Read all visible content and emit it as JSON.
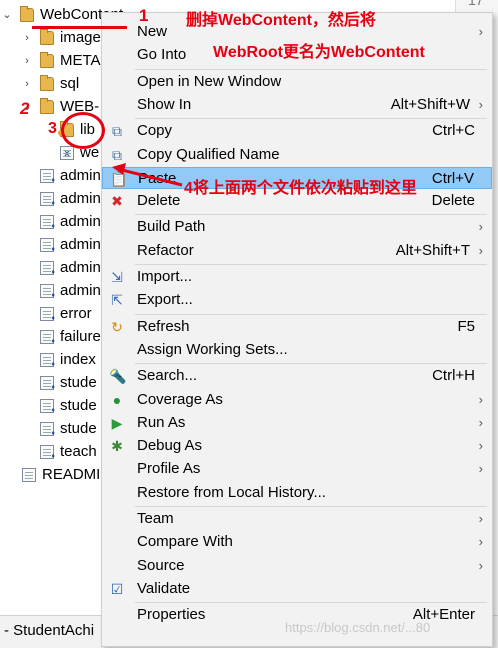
{
  "tree": {
    "root": {
      "label": "WebContent",
      "expander": "⌄"
    },
    "items": [
      {
        "label": "image",
        "icon": "folder-icon",
        "expander": "›"
      },
      {
        "label": "META",
        "icon": "folder-icon",
        "expander": "›"
      },
      {
        "label": "sql",
        "icon": "folder-icon",
        "expander": "›"
      },
      {
        "label": "WEB-",
        "icon": "folder-icon",
        "expander": "⌄"
      },
      {
        "label": "lib",
        "icon": "library-folder-icon",
        "expander": ""
      },
      {
        "label": "we",
        "icon": "xml-file-icon",
        "expander": ""
      },
      {
        "label": "admin",
        "icon": "jsp-file-icon"
      },
      {
        "label": "admin",
        "icon": "jsp-file-icon"
      },
      {
        "label": "admin",
        "icon": "jsp-file-icon"
      },
      {
        "label": "admin",
        "icon": "jsp-file-icon"
      },
      {
        "label": "admin",
        "icon": "jsp-file-icon"
      },
      {
        "label": "admin",
        "icon": "jsp-file-icon"
      },
      {
        "label": "error",
        "icon": "jsp-file-icon"
      },
      {
        "label": "failure",
        "icon": "jsp-file-icon"
      },
      {
        "label": "index",
        "icon": "jsp-file-icon"
      },
      {
        "label": "stude",
        "icon": "jsp-file-icon"
      },
      {
        "label": "stude",
        "icon": "jsp-file-icon"
      },
      {
        "label": "stude",
        "icon": "jsp-file-icon"
      },
      {
        "label": "teach",
        "icon": "jsp-file-icon"
      },
      {
        "label": "READMI",
        "icon": "text-file-icon"
      }
    ]
  },
  "bottom_bar": {
    "label": "- StudentAchi"
  },
  "right_panel": {
    "label": "17"
  },
  "context_menu": {
    "items": [
      {
        "label": "New",
        "shortcut": "",
        "submenu": true,
        "icon": ""
      },
      {
        "label": "Go Into",
        "shortcut": "",
        "submenu": false,
        "icon": ""
      },
      {
        "separator": true
      },
      {
        "label": "Open in New Window",
        "shortcut": "",
        "submenu": false,
        "icon": ""
      },
      {
        "label": "Show In",
        "shortcut": "Alt+Shift+W",
        "submenu": true,
        "icon": ""
      },
      {
        "separator": true
      },
      {
        "label": "Copy",
        "shortcut": "Ctrl+C",
        "submenu": false,
        "icon": "copy-icon"
      },
      {
        "label": "Copy Qualified Name",
        "shortcut": "",
        "submenu": false,
        "icon": "copy-qualified-icon"
      },
      {
        "label": "Paste",
        "shortcut": "Ctrl+V",
        "submenu": false,
        "icon": "paste-icon",
        "highlighted": true
      },
      {
        "label": "Delete",
        "shortcut": "Delete",
        "submenu": false,
        "icon": "delete-icon"
      },
      {
        "separator": true
      },
      {
        "label": "Build Path",
        "shortcut": "",
        "submenu": true,
        "icon": ""
      },
      {
        "label": "Refactor",
        "shortcut": "Alt+Shift+T",
        "submenu": true,
        "icon": ""
      },
      {
        "separator": true
      },
      {
        "label": "Import...",
        "shortcut": "",
        "submenu": false,
        "icon": "import-icon"
      },
      {
        "label": "Export...",
        "shortcut": "",
        "submenu": false,
        "icon": "export-icon"
      },
      {
        "separator": true
      },
      {
        "label": "Refresh",
        "shortcut": "F5",
        "submenu": false,
        "icon": "refresh-icon"
      },
      {
        "label": "Assign Working Sets...",
        "shortcut": "",
        "submenu": false,
        "icon": ""
      },
      {
        "separator": true
      },
      {
        "label": "Search...",
        "shortcut": "Ctrl+H",
        "submenu": false,
        "icon": "search-icon"
      },
      {
        "label": "Coverage As",
        "shortcut": "",
        "submenu": true,
        "icon": "coverage-icon"
      },
      {
        "label": "Run As",
        "shortcut": "",
        "submenu": true,
        "icon": "run-icon"
      },
      {
        "label": "Debug As",
        "shortcut": "",
        "submenu": true,
        "icon": "debug-icon"
      },
      {
        "label": "Profile As",
        "shortcut": "",
        "submenu": true,
        "icon": ""
      },
      {
        "label": "Restore from Local History...",
        "shortcut": "",
        "submenu": false,
        "icon": ""
      },
      {
        "separator": true
      },
      {
        "label": "Team",
        "shortcut": "",
        "submenu": true,
        "icon": ""
      },
      {
        "label": "Compare With",
        "shortcut": "",
        "submenu": true,
        "icon": ""
      },
      {
        "label": "Source",
        "shortcut": "",
        "submenu": true,
        "icon": ""
      },
      {
        "label": "Validate",
        "shortcut": "",
        "submenu": false,
        "icon": "check-icon"
      },
      {
        "separator": true
      },
      {
        "label": "Properties",
        "shortcut": "Alt+Enter",
        "submenu": false,
        "icon": ""
      }
    ]
  },
  "annotations": {
    "num1": "1",
    "num2": "2",
    "num3": "3",
    "text1": "删掉WebContent，然后将",
    "text2": "WebRoot更名为WebContent",
    "text4": "4将上面两个文件依次粘贴到这里"
  },
  "watermark": "https://blog.csdn.net/...80",
  "colors": {
    "highlight": "#91c9f7",
    "annotation": "#e60012",
    "menu_bg": "#f2f2f2"
  }
}
